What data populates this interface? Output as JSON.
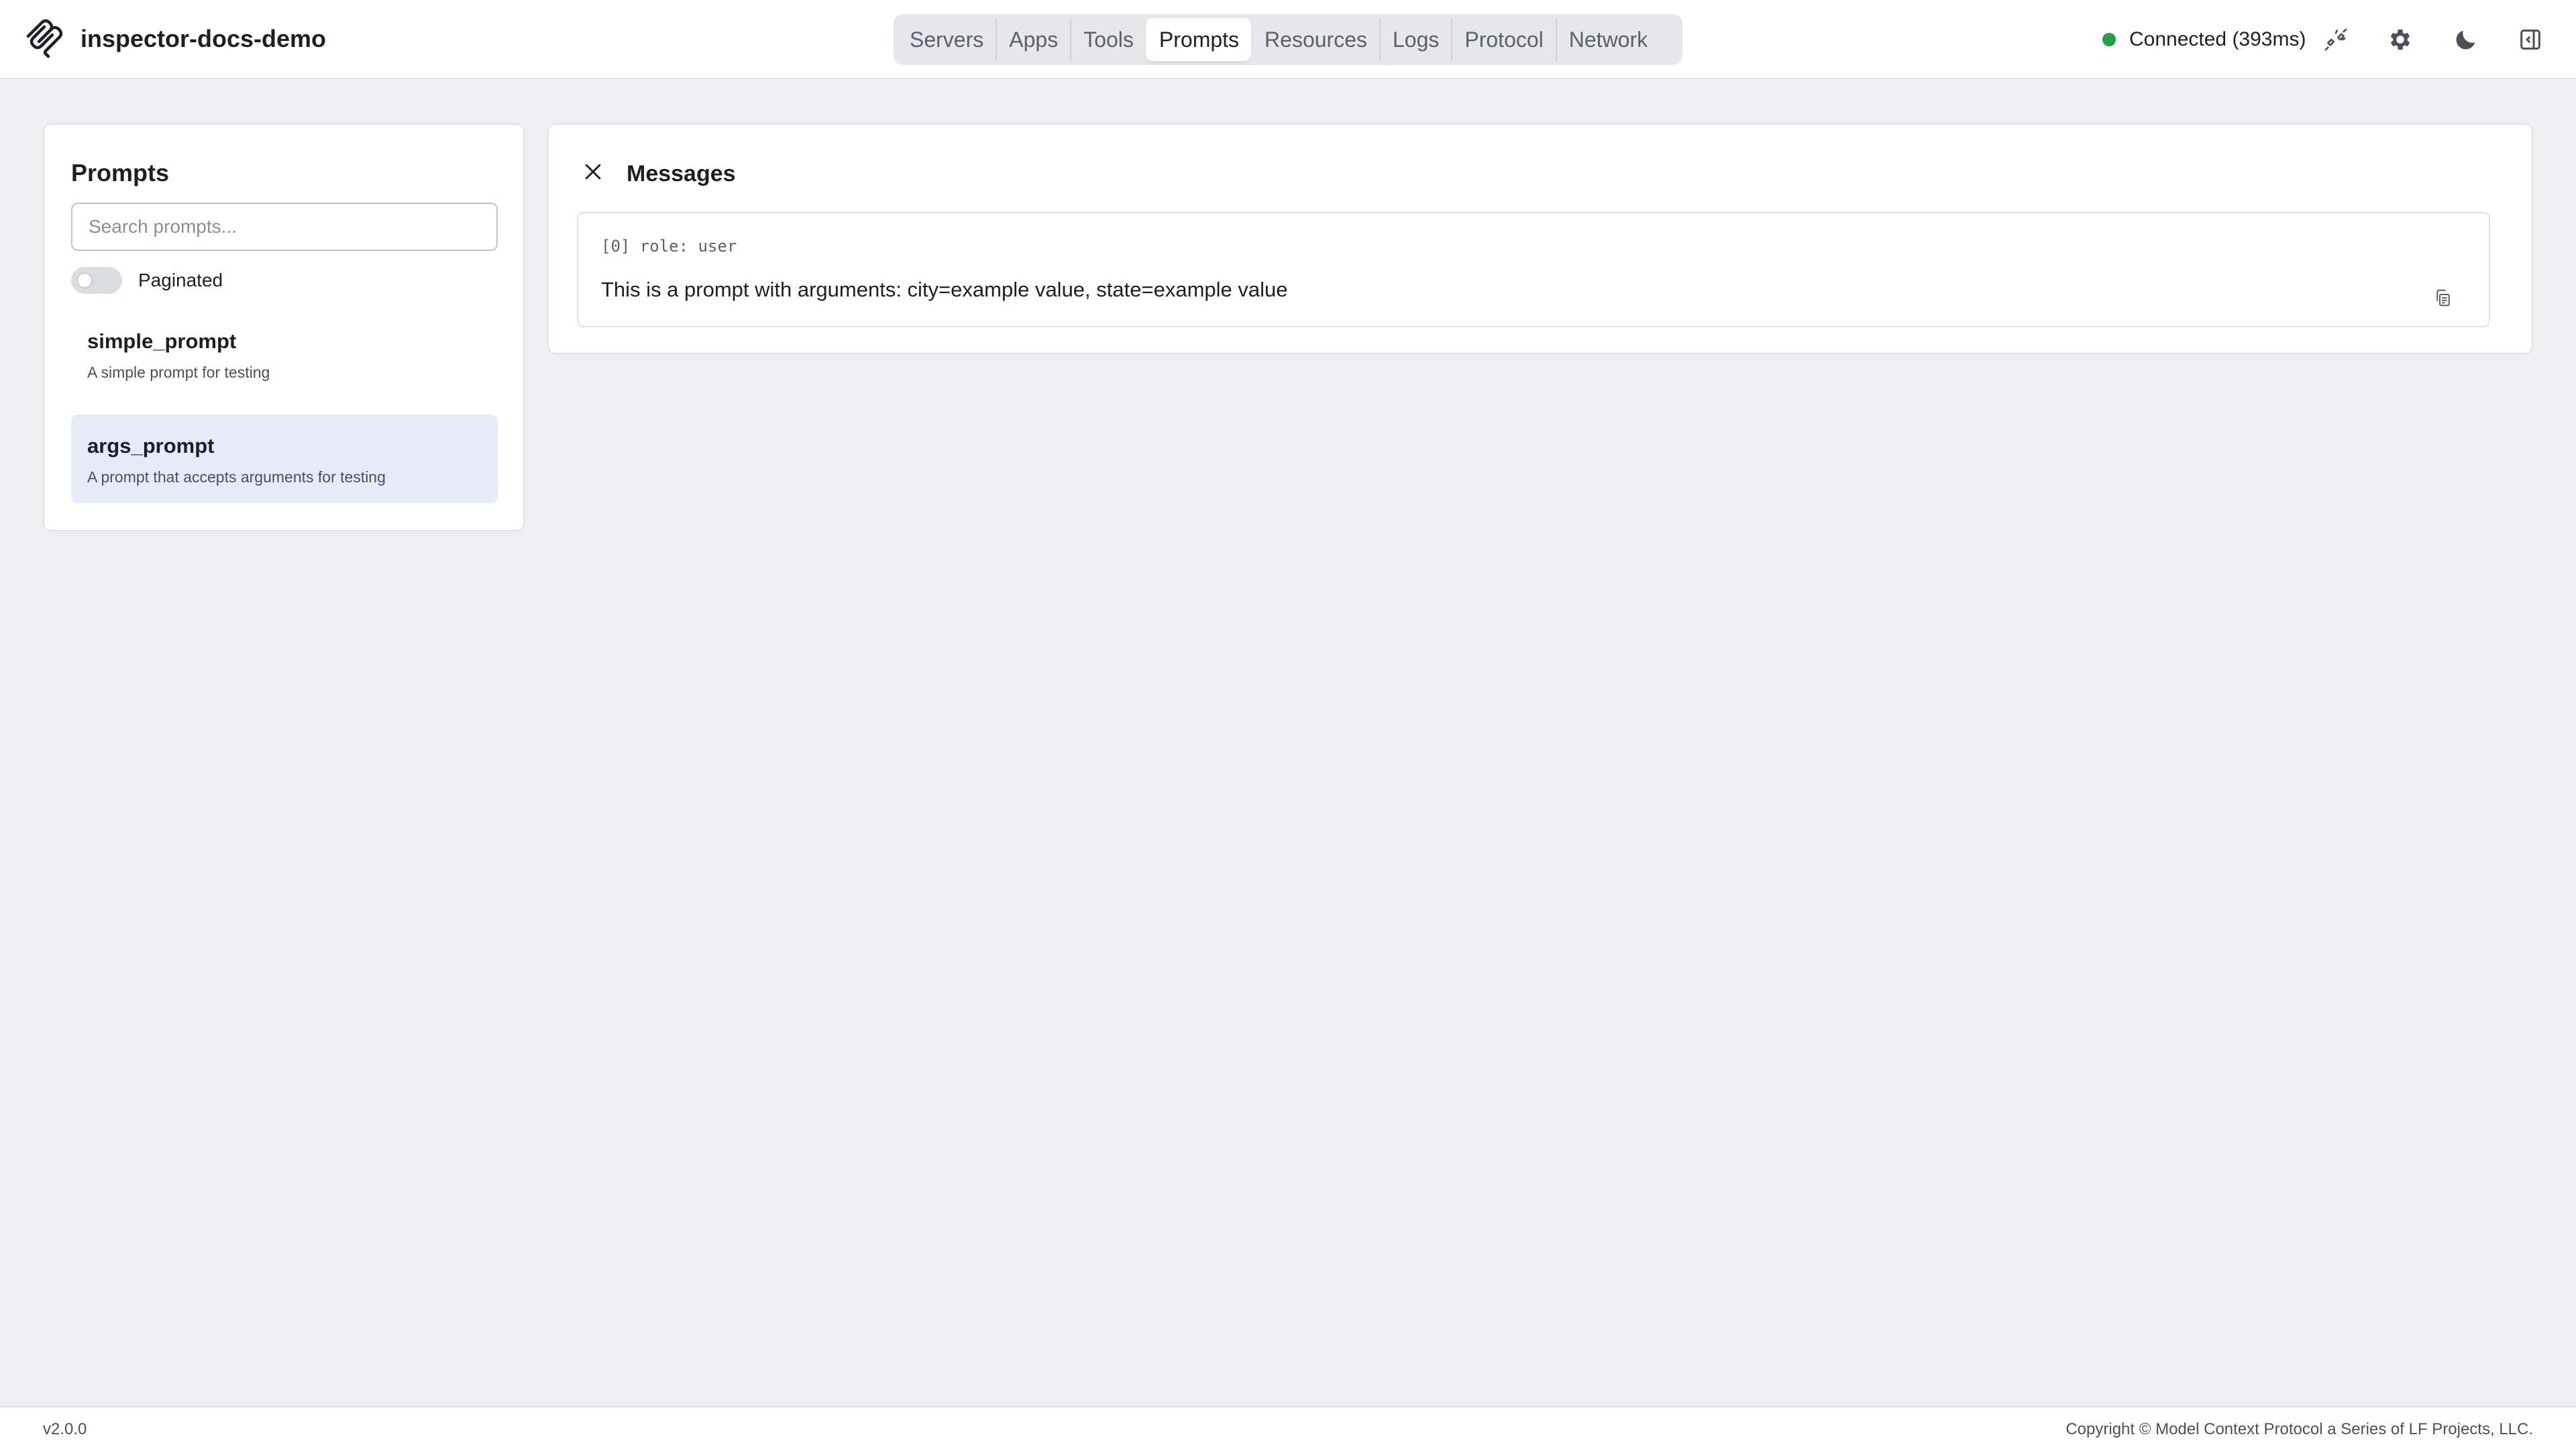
{
  "header": {
    "app_title": "inspector-docs-demo",
    "tabs": [
      {
        "label": "Servers",
        "active": false
      },
      {
        "label": "Apps",
        "active": false
      },
      {
        "label": "Tools",
        "active": false
      },
      {
        "label": "Prompts",
        "active": true
      },
      {
        "label": "Resources",
        "active": false
      },
      {
        "label": "Logs",
        "active": false
      },
      {
        "label": "Protocol",
        "active": false
      },
      {
        "label": "Network",
        "active": false
      }
    ],
    "status": {
      "text": "Connected (393ms)",
      "color": "#1ea34a"
    },
    "icons": [
      "disconnect-plug-icon",
      "settings-gear-icon",
      "dark-mode-moon-icon",
      "sidebar-toggle-icon"
    ]
  },
  "prompts_panel": {
    "title": "Prompts",
    "search_placeholder": "Search prompts...",
    "search_value": "",
    "paginated_label": "Paginated",
    "paginated_on": false,
    "items": [
      {
        "name": "simple_prompt",
        "description": "A simple prompt for testing",
        "selected": false
      },
      {
        "name": "args_prompt",
        "description": "A prompt that accepts arguments for testing",
        "selected": true
      }
    ]
  },
  "messages_panel": {
    "title": "Messages",
    "messages": [
      {
        "role_label": "[0] role: user",
        "text": "This is a prompt with arguments: city=example value, state=example value"
      }
    ]
  },
  "footer": {
    "version": "v2.0.0",
    "copyright": "Copyright © Model Context Protocol a Series of LF Projects, LLC."
  },
  "colors": {
    "page_bg": "#eeeff3",
    "selected_item_bg": "#e7eaf8",
    "status_connected": "#1ea34a"
  }
}
